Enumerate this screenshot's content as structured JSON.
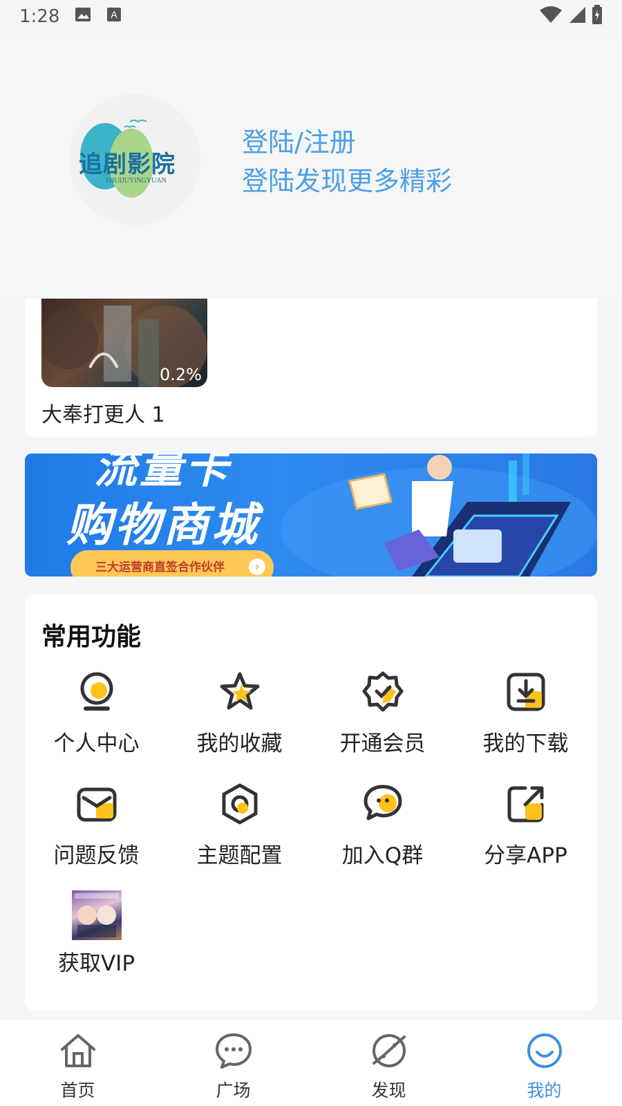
{
  "status": {
    "time": "1:28"
  },
  "header": {
    "logo_text": "追剧影院",
    "logo_subtext": "ZHUIJUYINGYUAN",
    "login_link": "登陆/注册",
    "login_tagline": "登陆发现更多精彩"
  },
  "recent": {
    "title": "大奉打更人 1",
    "progress": "0.2%"
  },
  "banner": {
    "top_text": "流量卡",
    "main_text": "购物商城",
    "pill_text": "三大运营商直签合作伙伴"
  },
  "functions": {
    "title": "常用功能",
    "items": [
      {
        "label": "个人中心",
        "icon": "user-icon"
      },
      {
        "label": "我的收藏",
        "icon": "star-icon"
      },
      {
        "label": "开通会员",
        "icon": "vip-badge-icon"
      },
      {
        "label": "我的下载",
        "icon": "download-icon"
      },
      {
        "label": "问题反馈",
        "icon": "mail-icon"
      },
      {
        "label": "主题配置",
        "icon": "theme-icon"
      },
      {
        "label": "加入Q群",
        "icon": "chat-group-icon"
      },
      {
        "label": "分享APP",
        "icon": "share-icon"
      },
      {
        "label": "获取VIP",
        "icon": "vip-image"
      }
    ]
  },
  "tabs": [
    {
      "label": "首页",
      "icon": "home-icon"
    },
    {
      "label": "广场",
      "icon": "chat-bubble-icon"
    },
    {
      "label": "发现",
      "icon": "planet-icon"
    },
    {
      "label": "我的",
      "icon": "smile-icon",
      "active": true
    }
  ],
  "colors": {
    "accent": "#3c8ee5",
    "login_text": "#4aa0e6",
    "icon_yellow": "#ffc21a",
    "icon_dark": "#333333"
  }
}
